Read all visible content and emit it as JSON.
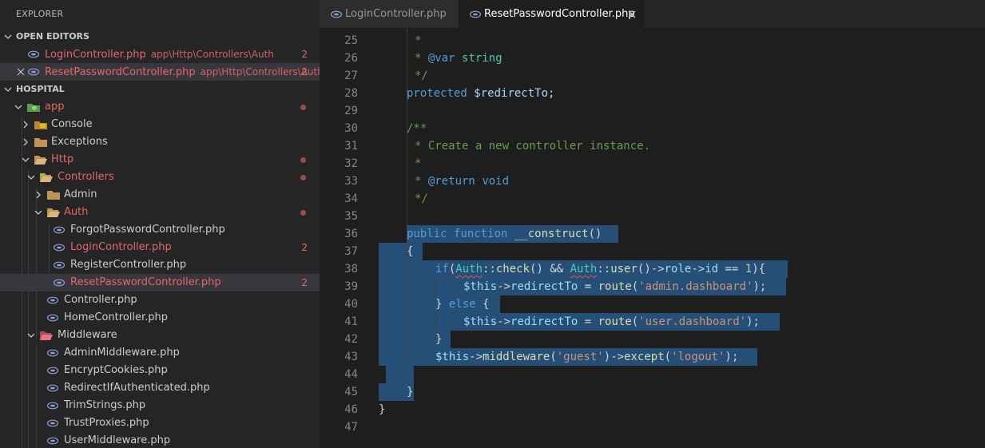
{
  "explorer": {
    "title": "EXPLORER"
  },
  "open_editors": {
    "label": "OPEN EDITORS",
    "items": [
      {
        "name": "LoginController.php",
        "path": "app\\Http\\Controllers\\Auth",
        "badge": "2"
      },
      {
        "name": "ResetPasswordController.php",
        "path": "app\\Http\\Controllers\\Auth",
        "badge": "2"
      }
    ]
  },
  "project": {
    "label": "HOSPITAL",
    "tree": {
      "app": "app",
      "console": "Console",
      "exceptions": "Exceptions",
      "http": "Http",
      "controllers": "Controllers",
      "admin": "Admin",
      "auth": "Auth",
      "forgot": "ForgotPasswordController.php",
      "login": "LoginController.php",
      "login_badge": "2",
      "register": "RegisterController.php",
      "reset": "ResetPasswordController.php",
      "reset_badge": "2",
      "controller": "Controller.php",
      "home": "HomeController.php",
      "middleware": "Middleware",
      "admin_mw": "AdminMiddleware.php",
      "encrypt": "EncryptCookies.php",
      "redirect": "RedirectIfAuthenticated.php",
      "trim": "TrimStrings.php",
      "trust": "TrustProxies.php",
      "user_mw": "UserMiddleware.php"
    }
  },
  "tabs": [
    {
      "label": "LoginController.php",
      "active": false
    },
    {
      "label": "ResetPasswordController.php",
      "active": true
    }
  ],
  "editor": {
    "line_numbers": [
      "25",
      "26",
      "27",
      "28",
      "29",
      "30",
      "31",
      "32",
      "33",
      "34",
      "35",
      "36",
      "37",
      "38",
      "39",
      "40",
      "41",
      "42",
      "43",
      "44",
      "45",
      "46",
      "47"
    ],
    "lines": {
      "l25": "*",
      "l26": "* @var string",
      "l27": "*/",
      "l28a": "protected ",
      "l28b": "$redirectTo",
      ";": ";",
      "l30": "/**",
      "l31": "* Create a new controller instance.",
      "l32": "*",
      "l33": "* @return void",
      "l34": "*/",
      "l36a": "public",
      "l36b": "function",
      "l36c": "__construct",
      "l38a": "if",
      "l38b": "Auth",
      "l38c": "check",
      "l38d": "user",
      "l38e": "role",
      "l38f": "id",
      "l38g": "1",
      "l39a": "$this",
      "l39b": "redirectTo",
      "l39c": "route",
      "l39d": "'admin.dashboard'",
      "l40": "} else {",
      "l41a": "$this",
      "l41b": "redirectTo",
      "l41c": "route",
      "l41d": "'user.dashboard'",
      "l43a": "$this",
      "l43b": "middleware",
      "l43c": "'guest'",
      "l43d": "except",
      "l43e": "'logout'"
    }
  },
  "colors": {
    "accent": "#007acc",
    "modified": "#e4676b",
    "selection": "#264f78",
    "comment": "#6a9955",
    "keyword": "#569cd6",
    "string": "#ce9178"
  }
}
